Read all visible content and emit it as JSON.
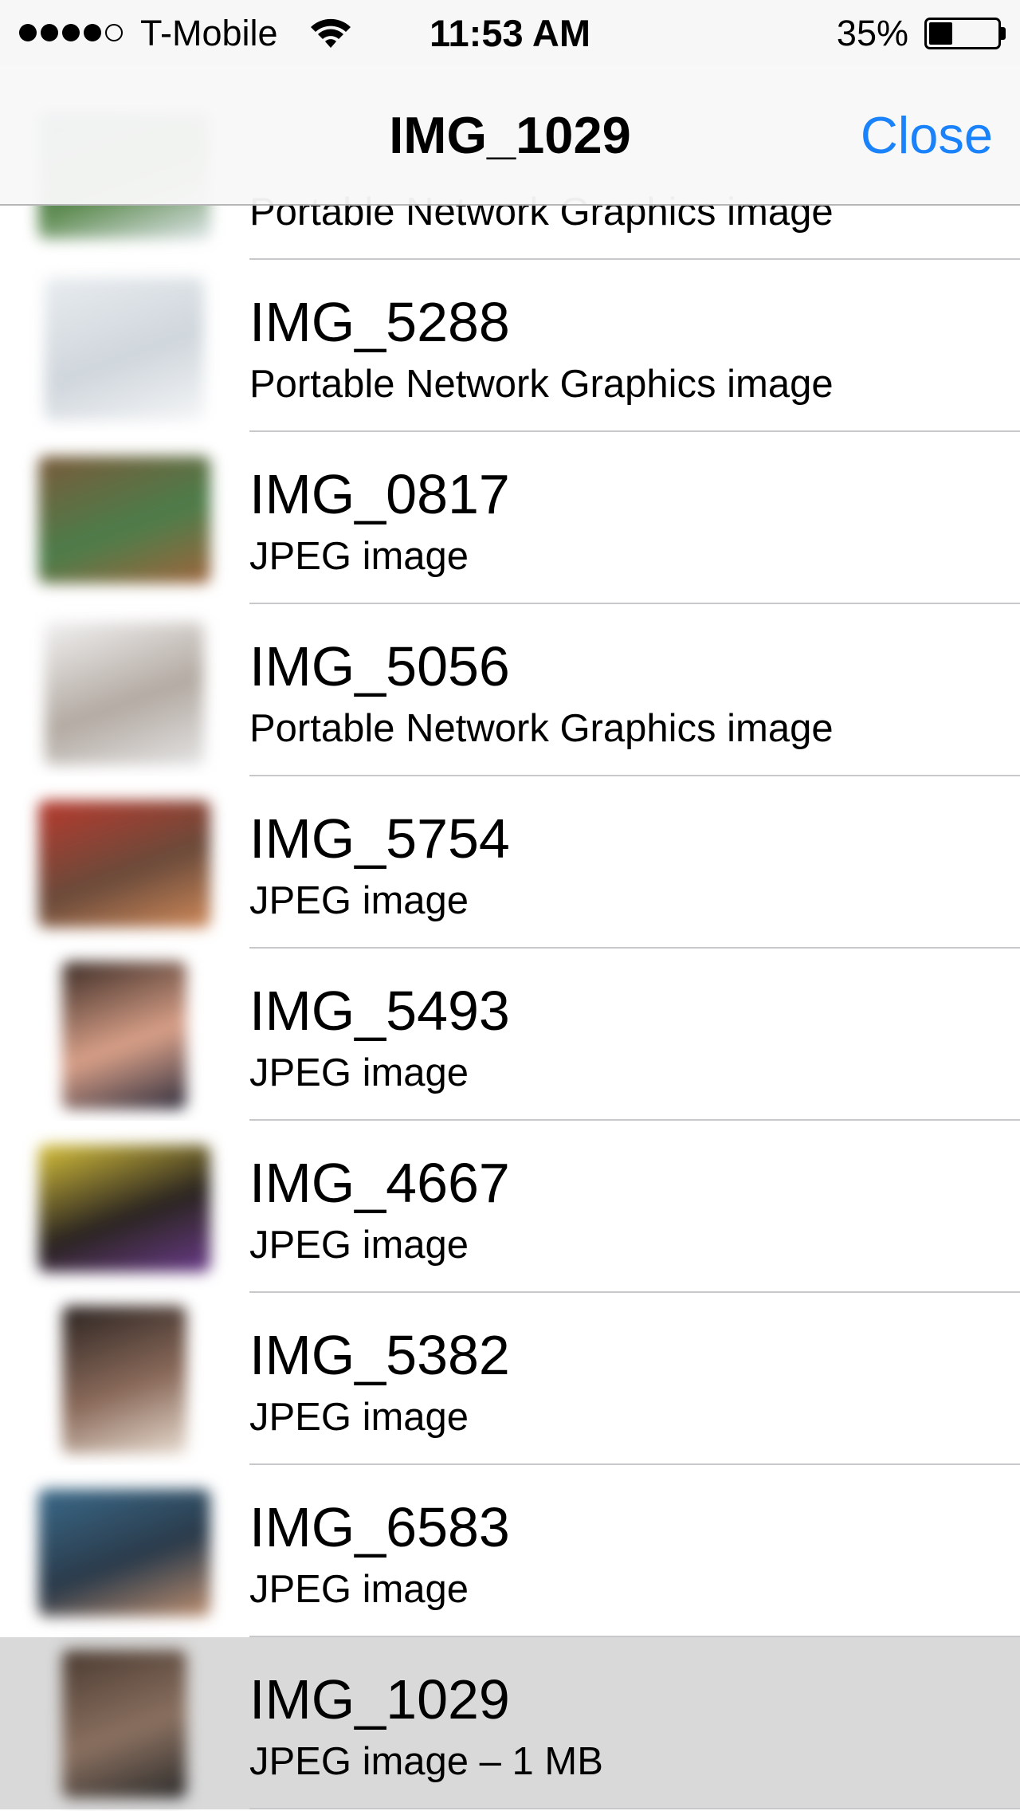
{
  "status_bar": {
    "carrier": "T-Mobile",
    "time": "11:53 AM",
    "battery_percent": "35%",
    "signal_bars_filled": 4,
    "signal_bars_total": 5,
    "battery_level": 0.35
  },
  "nav": {
    "title": "IMG_1029",
    "close_label": "Close"
  },
  "files": [
    {
      "name": "",
      "subtitle": "Portable Network Graphics image",
      "thumb_colors": [
        "#3d5a6c",
        "#5c8a4e",
        "#dfe6ea"
      ]
    },
    {
      "name": "IMG_5288",
      "subtitle": "Portable Network Graphics image",
      "thumb_colors": [
        "#e8ecef",
        "#cfd6dc",
        "#f5f6f7"
      ]
    },
    {
      "name": "IMG_0817",
      "subtitle": "JPEG image",
      "thumb_colors": [
        "#7a5a3a",
        "#4c7d4a",
        "#a0643c"
      ]
    },
    {
      "name": "IMG_5056",
      "subtitle": "Portable Network Graphics image",
      "thumb_colors": [
        "#f1f1f1",
        "#b3aaa2",
        "#e4e4e4"
      ]
    },
    {
      "name": "IMG_5754",
      "subtitle": "JPEG image",
      "thumb_colors": [
        "#b83a2e",
        "#6a4a3a",
        "#d08a5a"
      ]
    },
    {
      "name": "IMG_5493",
      "subtitle": "JPEG image",
      "thumb_colors": [
        "#3a2a24",
        "#d9a088",
        "#2c2c3c"
      ]
    },
    {
      "name": "IMG_4667",
      "subtitle": "JPEG image",
      "thumb_colors": [
        "#d8c23a",
        "#2a2420",
        "#6a3a8a"
      ]
    },
    {
      "name": "IMG_5382",
      "subtitle": "JPEG image",
      "thumb_colors": [
        "#2a2220",
        "#8a6a5a",
        "#e8dcd0"
      ]
    },
    {
      "name": "IMG_6583",
      "subtitle": "JPEG image",
      "thumb_colors": [
        "#3a6a8a",
        "#2a3a4a",
        "#c09070"
      ]
    },
    {
      "name": "IMG_1029",
      "subtitle": "JPEG image – 1 MB",
      "selected": true,
      "thumb_colors": [
        "#4a3a30",
        "#8a7060",
        "#2a2a2a"
      ]
    }
  ],
  "colors": {
    "accent": "#1a82fb",
    "selected_row": "#d9d9d9",
    "separator": "#c8c7cc"
  }
}
